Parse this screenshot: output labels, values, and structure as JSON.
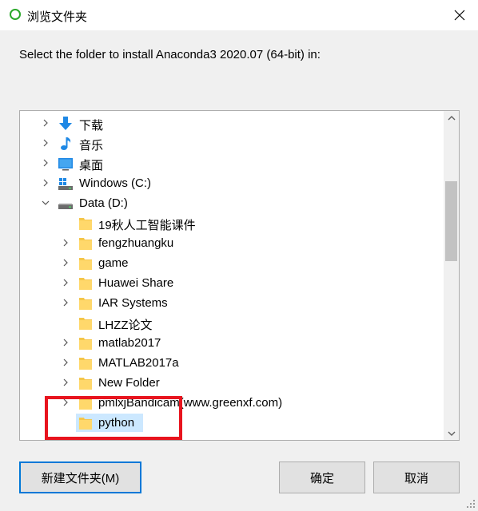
{
  "window": {
    "title": "浏览文件夹",
    "icon": "circle-app-icon",
    "close_icon": "close-icon",
    "accent": "#0078d7"
  },
  "prompt": "Select the folder to install Anaconda3 2020.07 (64-bit) in:",
  "tree": {
    "items": [
      {
        "label": "下载",
        "icon": "download-arrow-icon",
        "expander": "collapsed"
      },
      {
        "label": "音乐",
        "icon": "music-note-icon",
        "expander": "collapsed"
      },
      {
        "label": "桌面",
        "icon": "desktop-icon",
        "expander": "collapsed"
      },
      {
        "label": "Windows (C:)",
        "icon": "system-drive-icon",
        "expander": "collapsed"
      },
      {
        "label": "Data (D:)",
        "icon": "drive-icon",
        "expander": "expanded"
      },
      {
        "label": "19秋人工智能课件",
        "icon": "folder-icon",
        "expander": "none"
      },
      {
        "label": "fengzhuangku",
        "icon": "folder-icon",
        "expander": "collapsed"
      },
      {
        "label": "game",
        "icon": "folder-icon",
        "expander": "collapsed"
      },
      {
        "label": "Huawei Share",
        "icon": "folder-icon",
        "expander": "collapsed"
      },
      {
        "label": "IAR Systems",
        "icon": "folder-icon",
        "expander": "collapsed"
      },
      {
        "label": "LHZZ论文",
        "icon": "folder-icon",
        "expander": "none"
      },
      {
        "label": "matlab2017",
        "icon": "folder-icon",
        "expander": "collapsed"
      },
      {
        "label": "MATLAB2017a",
        "icon": "folder-icon",
        "expander": "collapsed"
      },
      {
        "label": "New Folder",
        "icon": "folder-icon",
        "expander": "collapsed"
      },
      {
        "label": "pmlxjBandicam(www.greenxf.com)",
        "icon": "folder-icon",
        "expander": "collapsed"
      },
      {
        "label": "python",
        "icon": "folder-icon",
        "expander": "none",
        "selected": true
      }
    ],
    "selection_color": "#cce8ff",
    "annotation_color": "#e8141e"
  },
  "buttons": {
    "new_folder": "新建文件夹(M)",
    "ok": "确定",
    "cancel": "取消"
  }
}
